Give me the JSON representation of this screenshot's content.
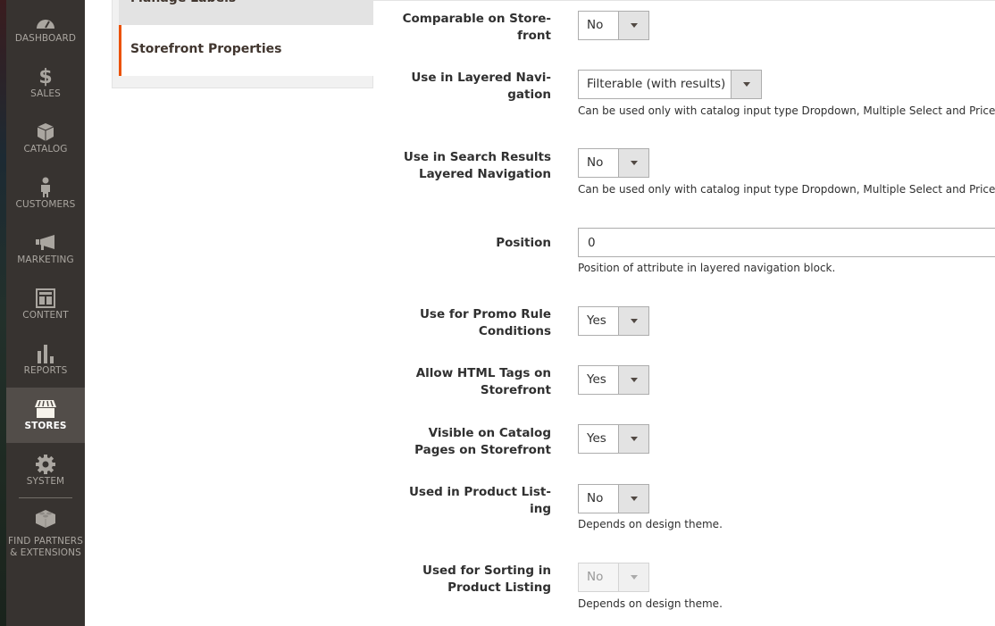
{
  "sidebar": {
    "items": [
      {
        "id": "dashboard",
        "label": "DASHBOARD",
        "icon": "dashboard-icon"
      },
      {
        "id": "sales",
        "label": "SALES",
        "icon": "dollar-icon"
      },
      {
        "id": "catalog",
        "label": "CATALOG",
        "icon": "box-icon"
      },
      {
        "id": "customers",
        "label": "CUSTOMERS",
        "icon": "person-icon"
      },
      {
        "id": "marketing",
        "label": "MARKETING",
        "icon": "megaphone-icon"
      },
      {
        "id": "content",
        "label": "CONTENT",
        "icon": "layout-icon"
      },
      {
        "id": "reports",
        "label": "REPORTS",
        "icon": "bar-chart-icon"
      },
      {
        "id": "stores",
        "label": "STORES",
        "icon": "storefront-icon",
        "active": true
      },
      {
        "id": "system",
        "label": "SYSTEM",
        "icon": "gear-icon"
      }
    ],
    "partners": {
      "line1": "FIND PARTNERS",
      "line2": "& EXTENSIONS",
      "icon": "lego-brick-icon"
    }
  },
  "tabs": {
    "manage_labels": "Manage Labels",
    "storefront_properties": "Storefront Properties"
  },
  "form": {
    "comparable": {
      "label_1": "Comparable on Store-",
      "label_2": "front",
      "value": "No"
    },
    "layered_nav": {
      "label_1": "Use in Layered Navi-",
      "label_2": "gation",
      "value": "Filterable (with results)",
      "note": "Can be used only with catalog input type Dropdown, Multiple Select and Price."
    },
    "search_layered_nav": {
      "label_1": "Use in Search Results",
      "label_2": "Layered Navigation",
      "value": "No",
      "note": "Can be used only with catalog input type Dropdown, Multiple Select and Price."
    },
    "position": {
      "label": "Position",
      "value": "0",
      "note": "Position of attribute in layered navigation block."
    },
    "promo_rule": {
      "label_1": "Use for Promo Rule",
      "label_2": "Conditions",
      "value": "Yes"
    },
    "html_tags": {
      "label_1": "Allow HTML Tags on",
      "label_2": "Storefront",
      "value": "Yes"
    },
    "visible_catalog": {
      "label_1": "Visible on Catalog",
      "label_2": "Pages on Storefront",
      "value": "Yes"
    },
    "product_listing": {
      "label_1": "Used in Product List-",
      "label_2": "ing",
      "value": "No",
      "note": "Depends on design theme."
    },
    "sorting": {
      "label_1": "Used for Sorting in",
      "label_2": "Product Listing",
      "value": "No",
      "disabled": true,
      "note": "Depends on design theme."
    }
  },
  "colors": {
    "accent": "#eb5202",
    "sidebar_bg": "#373330",
    "sidebar_active": "#524d49"
  }
}
